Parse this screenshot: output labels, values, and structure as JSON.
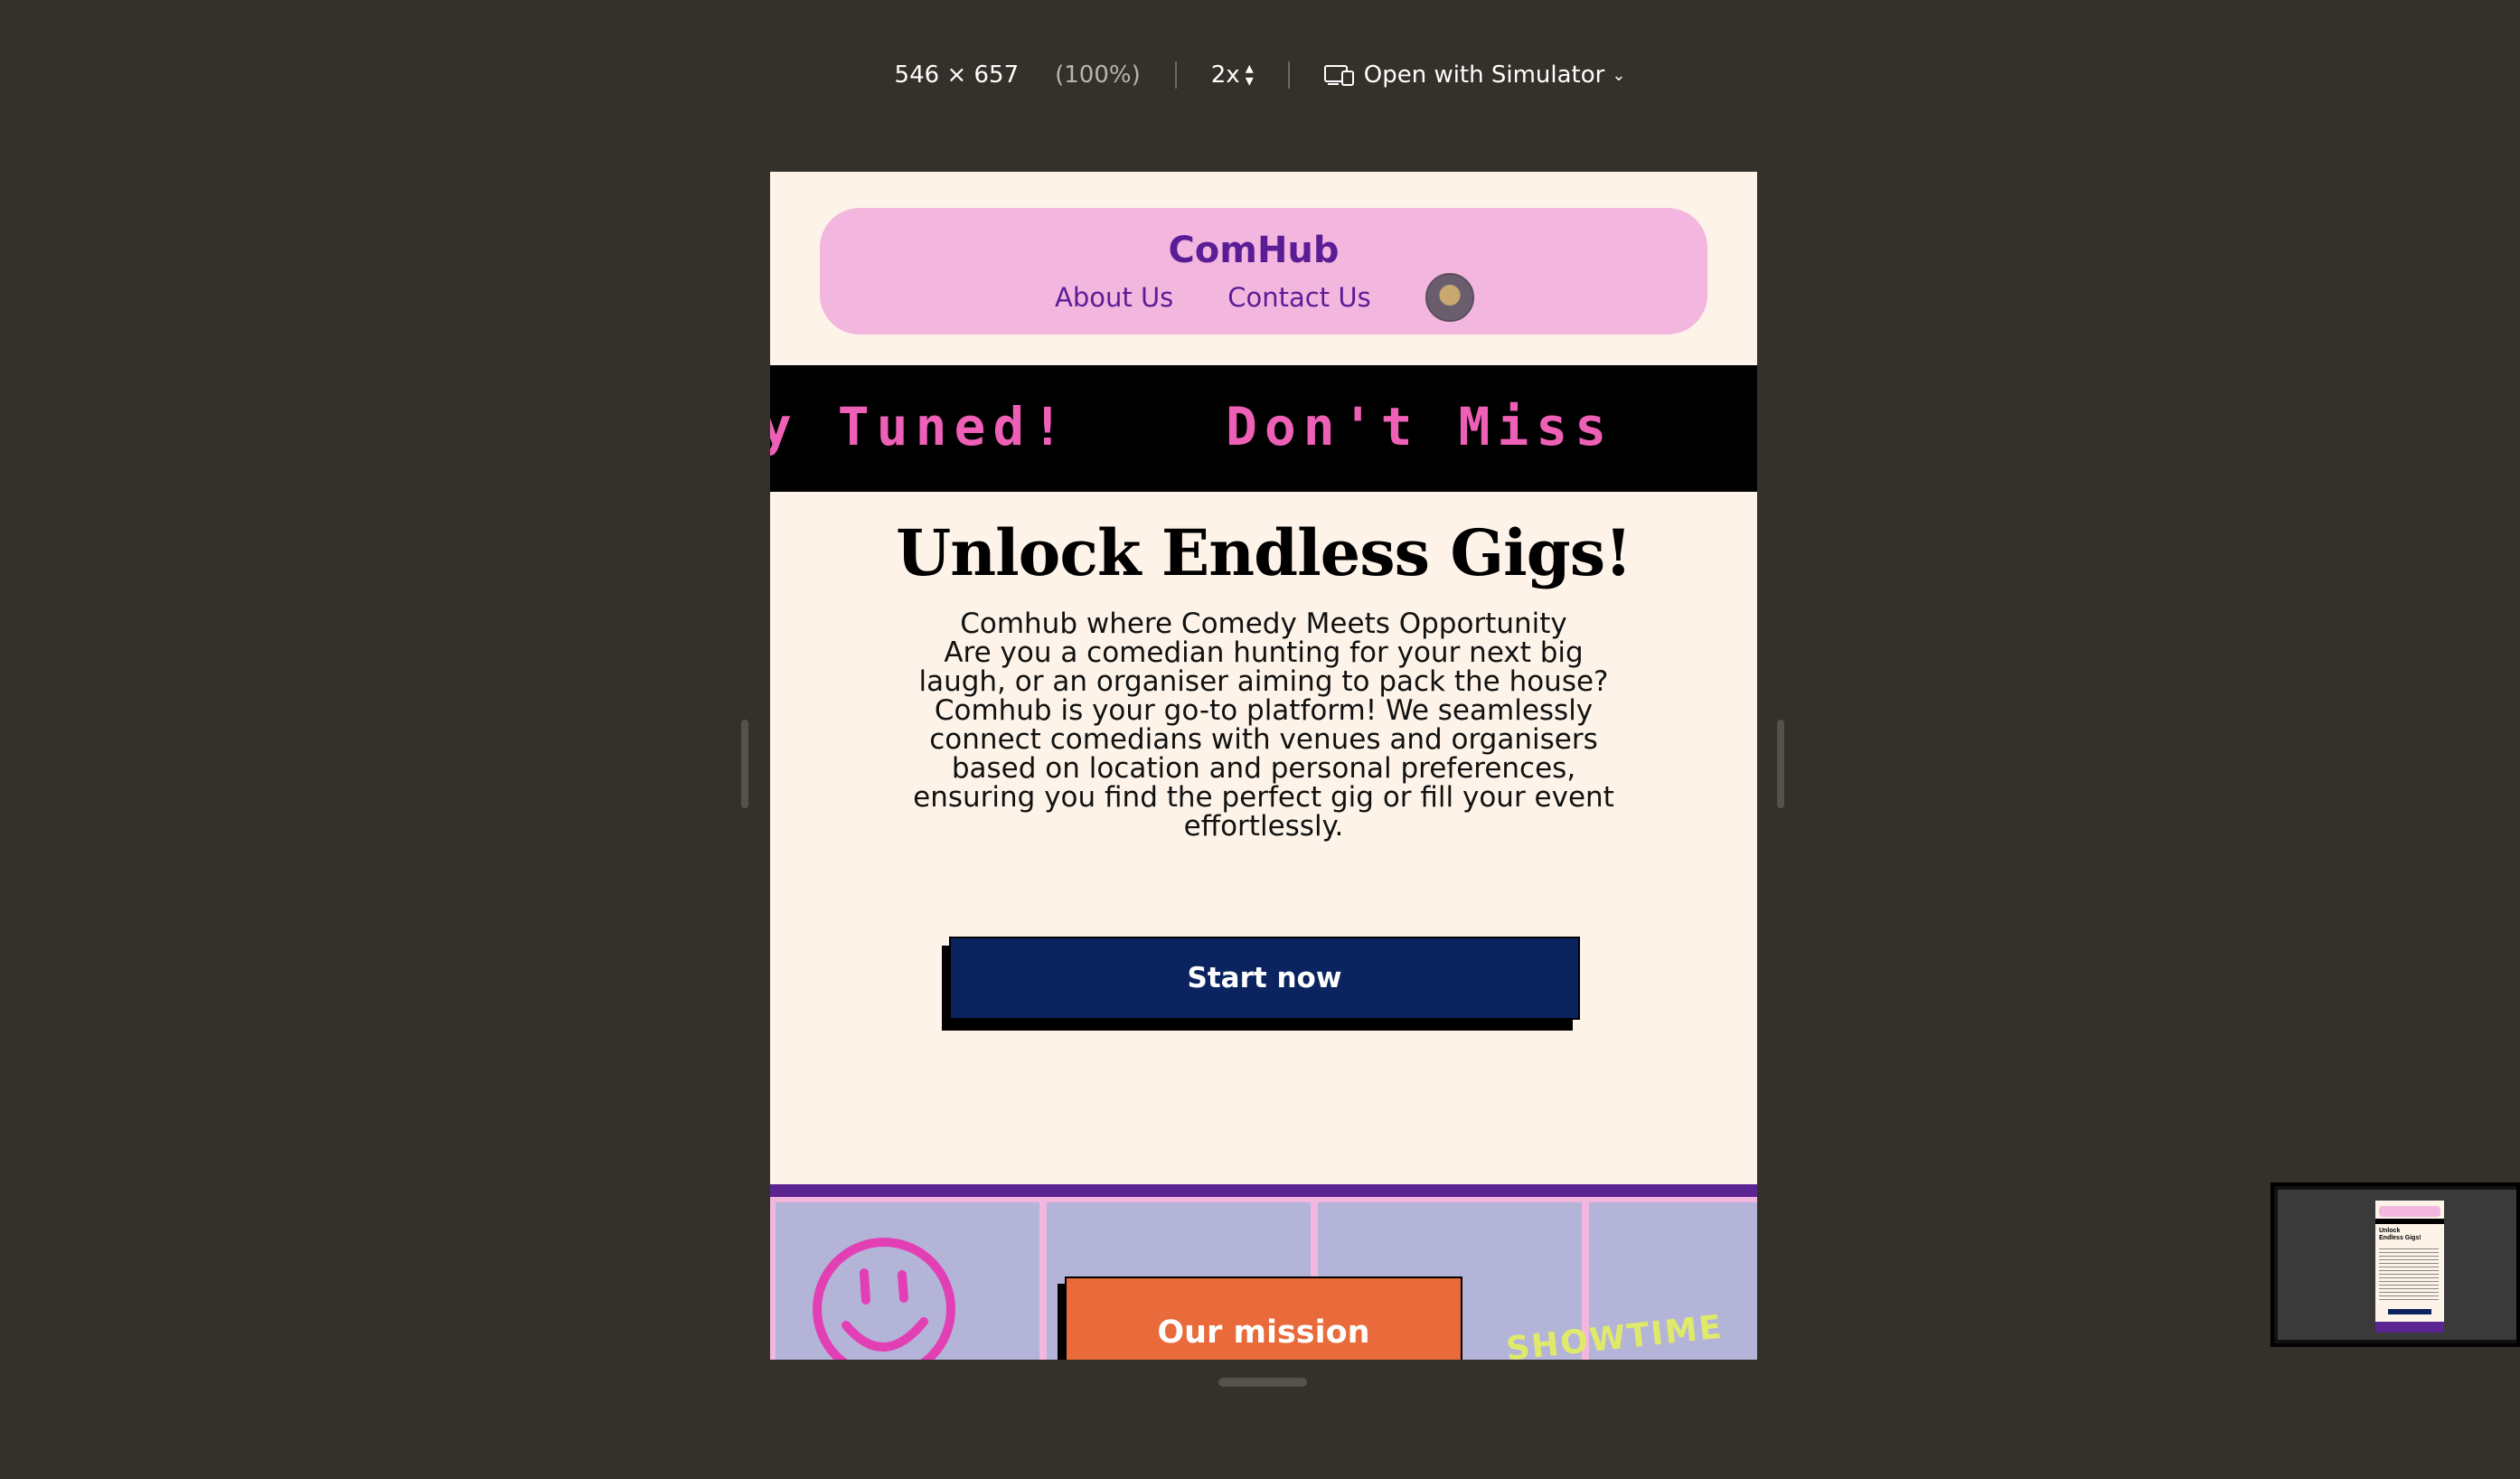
{
  "toolbar": {
    "dimensions": "546 × 657",
    "zoom": "(100%)",
    "scale": "2x",
    "open_with": "Open with Simulator"
  },
  "nav": {
    "brand": "ComHub",
    "links": [
      "About Us",
      "Contact Us"
    ]
  },
  "ticker": {
    "text": "ay Tuned!    Don't Miss"
  },
  "hero": {
    "title": "Unlock Endless Gigs!",
    "tagline": "Comhub where Comedy Meets Opportunity",
    "body": "Are you a comedian hunting for your next big laugh, or an organiser aiming to pack the house? Comhub is your go-to platform! We seamlessly connect comedians with venues and organisers based on location and personal preferences, ensuring you find the perfect gig or fill your event effortlessly.",
    "cta": "Start now"
  },
  "band": {
    "mission_button": "Our mission",
    "sticker": "SHOWTIME"
  },
  "colors": {
    "page_bg": "#fdf3e8",
    "nav_bg": "#f3b6de",
    "brand": "#5b1d96",
    "ticker_text": "#ee5fb6",
    "cta_bg": "#0b2460",
    "mission_bg": "#e96a3b"
  }
}
